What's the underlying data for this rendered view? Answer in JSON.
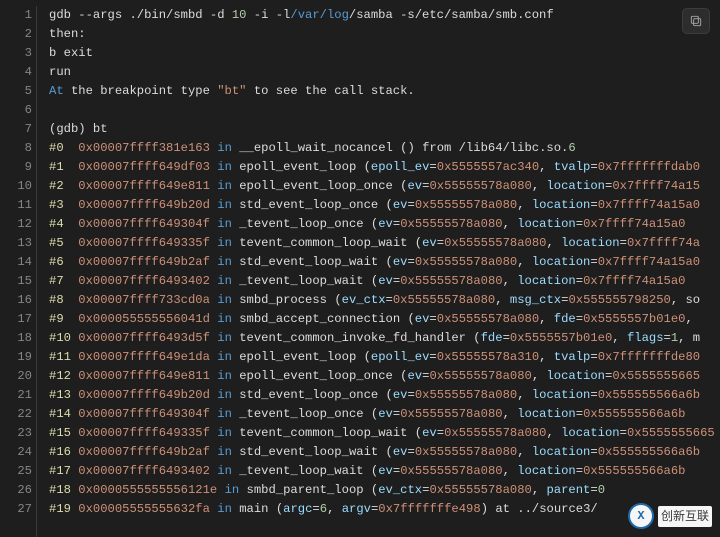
{
  "watermark": {
    "badge": "X",
    "text": "创新互联"
  },
  "total_lines": 27,
  "intro": {
    "cmd_parts": {
      "p1": "gdb --args ./bin/smbd -d ",
      "d_num": "10",
      "p2": " -i -l",
      "path1": "/var/",
      "log": "log",
      "p3": "/samba -s/etc/samba/smb.conf"
    },
    "then": "then:",
    "b_exit": "b exit",
    "run": "run",
    "at_line": {
      "at": "At",
      "mid": " the breakpoint type ",
      "bt": "\"bt\"",
      "end": " to see the call stack."
    },
    "gdb_bt": "(gdb) bt"
  },
  "frames": [
    {
      "idx": "#0",
      "addr": "0x00007ffff381e163",
      "in": "in",
      "body_plain": "__epoll_wait_nocancel () from /lib64/libc.so.",
      "trail_num": "6"
    },
    {
      "idx": "#1",
      "addr": "0x00007ffff649df03",
      "in": "in",
      "fn": "epoll_event_loop",
      "args": [
        [
          "epoll_ev",
          "0x5555557ac340"
        ],
        [
          "tvalp",
          "0x7fffffffdab0"
        ]
      ]
    },
    {
      "idx": "#2",
      "addr": "0x00007ffff649e811",
      "in": "in",
      "fn": "epoll_event_loop_once",
      "args": [
        [
          "ev",
          "0x55555578a080"
        ],
        [
          "location",
          "0x7ffff74a15"
        ]
      ]
    },
    {
      "idx": "#3",
      "addr": "0x00007ffff649b20d",
      "in": "in",
      "fn": "std_event_loop_once",
      "args": [
        [
          "ev",
          "0x55555578a080"
        ],
        [
          "location",
          "0x7ffff74a15a0"
        ]
      ]
    },
    {
      "idx": "#4",
      "addr": "0x00007ffff649304f",
      "in": "in",
      "fn": "_tevent_loop_once",
      "args": [
        [
          "ev",
          "0x55555578a080"
        ],
        [
          "location",
          "0x7ffff74a15a0"
        ]
      ]
    },
    {
      "idx": "#5",
      "addr": "0x00007ffff649335f",
      "in": "in",
      "fn": "tevent_common_loop_wait",
      "args": [
        [
          "ev",
          "0x55555578a080"
        ],
        [
          "location",
          "0x7ffff74a"
        ]
      ]
    },
    {
      "idx": "#6",
      "addr": "0x00007ffff649b2af",
      "in": "in",
      "fn": "std_event_loop_wait",
      "args": [
        [
          "ev",
          "0x55555578a080"
        ],
        [
          "location",
          "0x7ffff74a15a0"
        ]
      ]
    },
    {
      "idx": "#7",
      "addr": "0x00007ffff6493402",
      "in": "in",
      "fn": "_tevent_loop_wait",
      "args": [
        [
          "ev",
          "0x55555578a080"
        ],
        [
          "location",
          "0x7ffff74a15a0 "
        ]
      ]
    },
    {
      "idx": "#8",
      "addr": "0x00007ffff733cd0a",
      "in": "in",
      "fn": "smbd_process",
      "args": [
        [
          "ev_ctx",
          "0x55555578a080"
        ],
        [
          "msg_ctx",
          "0x555555798250"
        ],
        [
          "",
          ", so"
        ]
      ],
      "raw_tail": true
    },
    {
      "idx": "#9",
      "addr": "0x000055555556041d",
      "in": "in",
      "fn": "smbd_accept_connection",
      "args": [
        [
          "ev",
          "0x55555578a080"
        ],
        [
          "fde",
          "0x5555557b01e0"
        ],
        [
          "",
          ","
        ]
      ],
      "raw_tail": true
    },
    {
      "idx": "#10",
      "addr": "0x00007ffff6493d5f",
      "in": "in",
      "fn": "tevent_common_invoke_fd_handler",
      "args": [
        [
          "fde",
          "0x5555557b01e0"
        ],
        [
          "flags",
          "1"
        ],
        [
          "",
          ", m"
        ]
      ],
      "raw_tail": true
    },
    {
      "idx": "#11",
      "addr": "0x00007ffff649e1da",
      "in": "in",
      "fn": "epoll_event_loop",
      "args": [
        [
          "epoll_ev",
          "0x55555578a310"
        ],
        [
          "tvalp",
          "0x7fffffffde80"
        ]
      ]
    },
    {
      "idx": "#12",
      "addr": "0x00007ffff649e811",
      "in": "in",
      "fn": "epoll_event_loop_once",
      "args": [
        [
          "ev",
          "0x55555578a080"
        ],
        [
          "location",
          "0x5555555665"
        ]
      ]
    },
    {
      "idx": "#13",
      "addr": "0x00007ffff649b20d",
      "in": "in",
      "fn": "std_event_loop_once",
      "args": [
        [
          "ev",
          "0x55555578a080"
        ],
        [
          "location",
          "0x555555566a6b"
        ]
      ]
    },
    {
      "idx": "#14",
      "addr": "0x00007ffff649304f",
      "in": "in",
      "fn": "_tevent_loop_once",
      "args": [
        [
          "ev",
          "0x55555578a080"
        ],
        [
          "location",
          "0x555555566a6b"
        ]
      ]
    },
    {
      "idx": "#15",
      "addr": "0x00007ffff649335f",
      "in": "in",
      "fn": "tevent_common_loop_wait",
      "args": [
        [
          "ev",
          "0x55555578a080"
        ],
        [
          "location",
          "0x5555555665"
        ]
      ]
    },
    {
      "idx": "#16",
      "addr": "0x00007ffff649b2af",
      "in": "in",
      "fn": "std_event_loop_wait",
      "args": [
        [
          "ev",
          "0x55555578a080"
        ],
        [
          "location",
          "0x555555566a6b"
        ]
      ]
    },
    {
      "idx": "#17",
      "addr": "0x00007ffff6493402",
      "in": "in",
      "fn": "_tevent_loop_wait",
      "args": [
        [
          "ev",
          "0x55555578a080"
        ],
        [
          "location",
          "0x555555566a6b "
        ]
      ]
    },
    {
      "idx": "#18",
      "addr": "0x0000555555556121e",
      "in": "in",
      "fn": "smbd_parent_loop",
      "args": [
        [
          "ev_ctx",
          "0x55555578a080"
        ],
        [
          "parent",
          "0"
        ]
      ]
    },
    {
      "idx": "#19",
      "addr": "0x00005555555632fa",
      "in": "in",
      "fn": "main",
      "args_main": {
        "argc": "6",
        "argv": "0x7fffffffe498"
      },
      "tail": " at ../source3/"
    }
  ]
}
